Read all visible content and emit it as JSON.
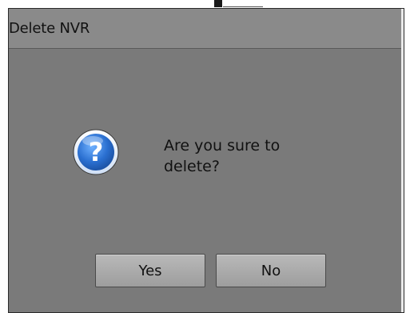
{
  "dialog": {
    "title": "Delete NVR",
    "message": "Are you sure to delete?",
    "icon": "question-icon",
    "buttons": {
      "yes": "Yes",
      "no": "No"
    }
  },
  "colors": {
    "dialog_bg": "#7a7a7a",
    "titlebar_bg": "#8a8a8a",
    "icon_blue": "#2a6fd0"
  }
}
